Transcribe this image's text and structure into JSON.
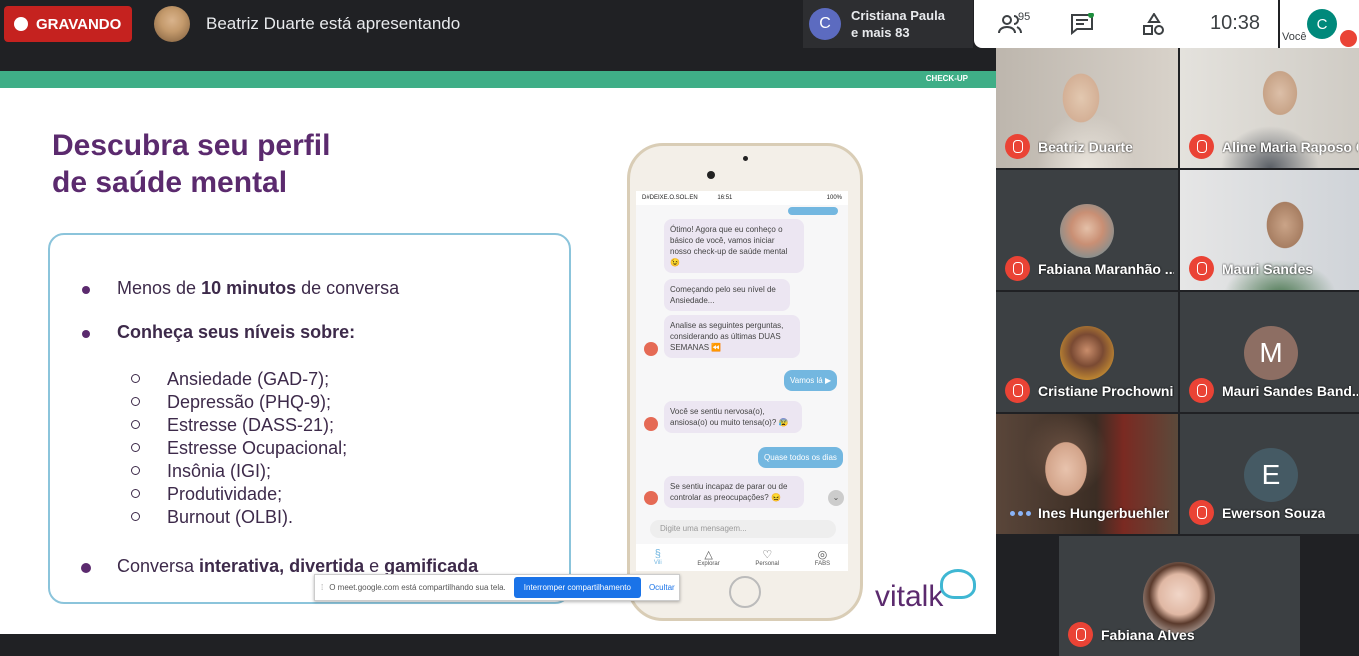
{
  "topbar": {
    "recording_label": "GRAVANDO",
    "presenting_text": "Beatriz Duarte está apresentando",
    "others_avatar_letter": "C",
    "others_line1": "Cristiana Paula",
    "others_line2": "e mais 83",
    "participants_count": "95",
    "clock": "10:38",
    "self_avatar_letter": "C",
    "self_label": "Você"
  },
  "slide": {
    "header_tag": "CHECK-UP",
    "title_line1": "Descubra seu perfil",
    "title_line2": "de saúde mental",
    "bullet1_pre": "Menos de ",
    "bullet1_bold": "10 minutos",
    "bullet1_post": " de conversa",
    "bullet2": "Conheça seus níveis sobre:",
    "sub_items": [
      "Ansiedade (GAD-7);",
      "Depressão (PHQ-9);",
      "Estresse (DASS-21);",
      "Estresse Ocupacional;",
      "Insônia (IGI);",
      "Produtividade;",
      "Burnout (OLBI)."
    ],
    "bullet3_pre": "Conversa ",
    "bullet3_bold1": "interativa, divertida",
    "bullet3_mid": " e ",
    "bullet3_bold2": "gamificada",
    "brand": "vitalk"
  },
  "phone": {
    "status_left": "D#DEIXE.O.SOL.EN",
    "status_time": "16:51",
    "status_right": "100%",
    "msg1": "Ótimo! Agora que eu conheço o básico de você, vamos iniciar nosso check-up de saúde mental 😉",
    "msg2": "Começando pelo seu nível de Ansiedade...",
    "msg3": "Analise as seguintes perguntas, considerando as últimas DUAS SEMANAS ⏪",
    "reply1": "Vamos lá ▶",
    "msg4": "Você se sentiu nervosa(o), ansiosa(o) ou muito tensa(o)? 😰",
    "reply2": "Quase todos os dias",
    "msg5": "Se sentiu incapaz de parar ou de controlar as preocupações? 😖",
    "input_placeholder": "Digite uma mensagem...",
    "nav": [
      "Vili",
      "Explorar",
      "Personal",
      "FABS"
    ]
  },
  "share_bar": {
    "text": "O meet.google.com está compartilhando sua tela.",
    "stop_button": "Interromper compartilhamento",
    "hide_button": "Ocultar"
  },
  "participants": [
    {
      "name": "Beatriz Duarte"
    },
    {
      "name": "Aline Maria Raposo Coelho"
    },
    {
      "name": "Fabiana Maranhão ..."
    },
    {
      "name": "Mauri Sandes"
    },
    {
      "name": "Cristiane Prochownik"
    },
    {
      "name": "Mauri Sandes Band...",
      "letter": "M"
    },
    {
      "name": "Ines Hungerbuehler"
    },
    {
      "name": "Ewerson Souza",
      "letter": "E"
    },
    {
      "name": "Fabiana Alves"
    }
  ]
}
